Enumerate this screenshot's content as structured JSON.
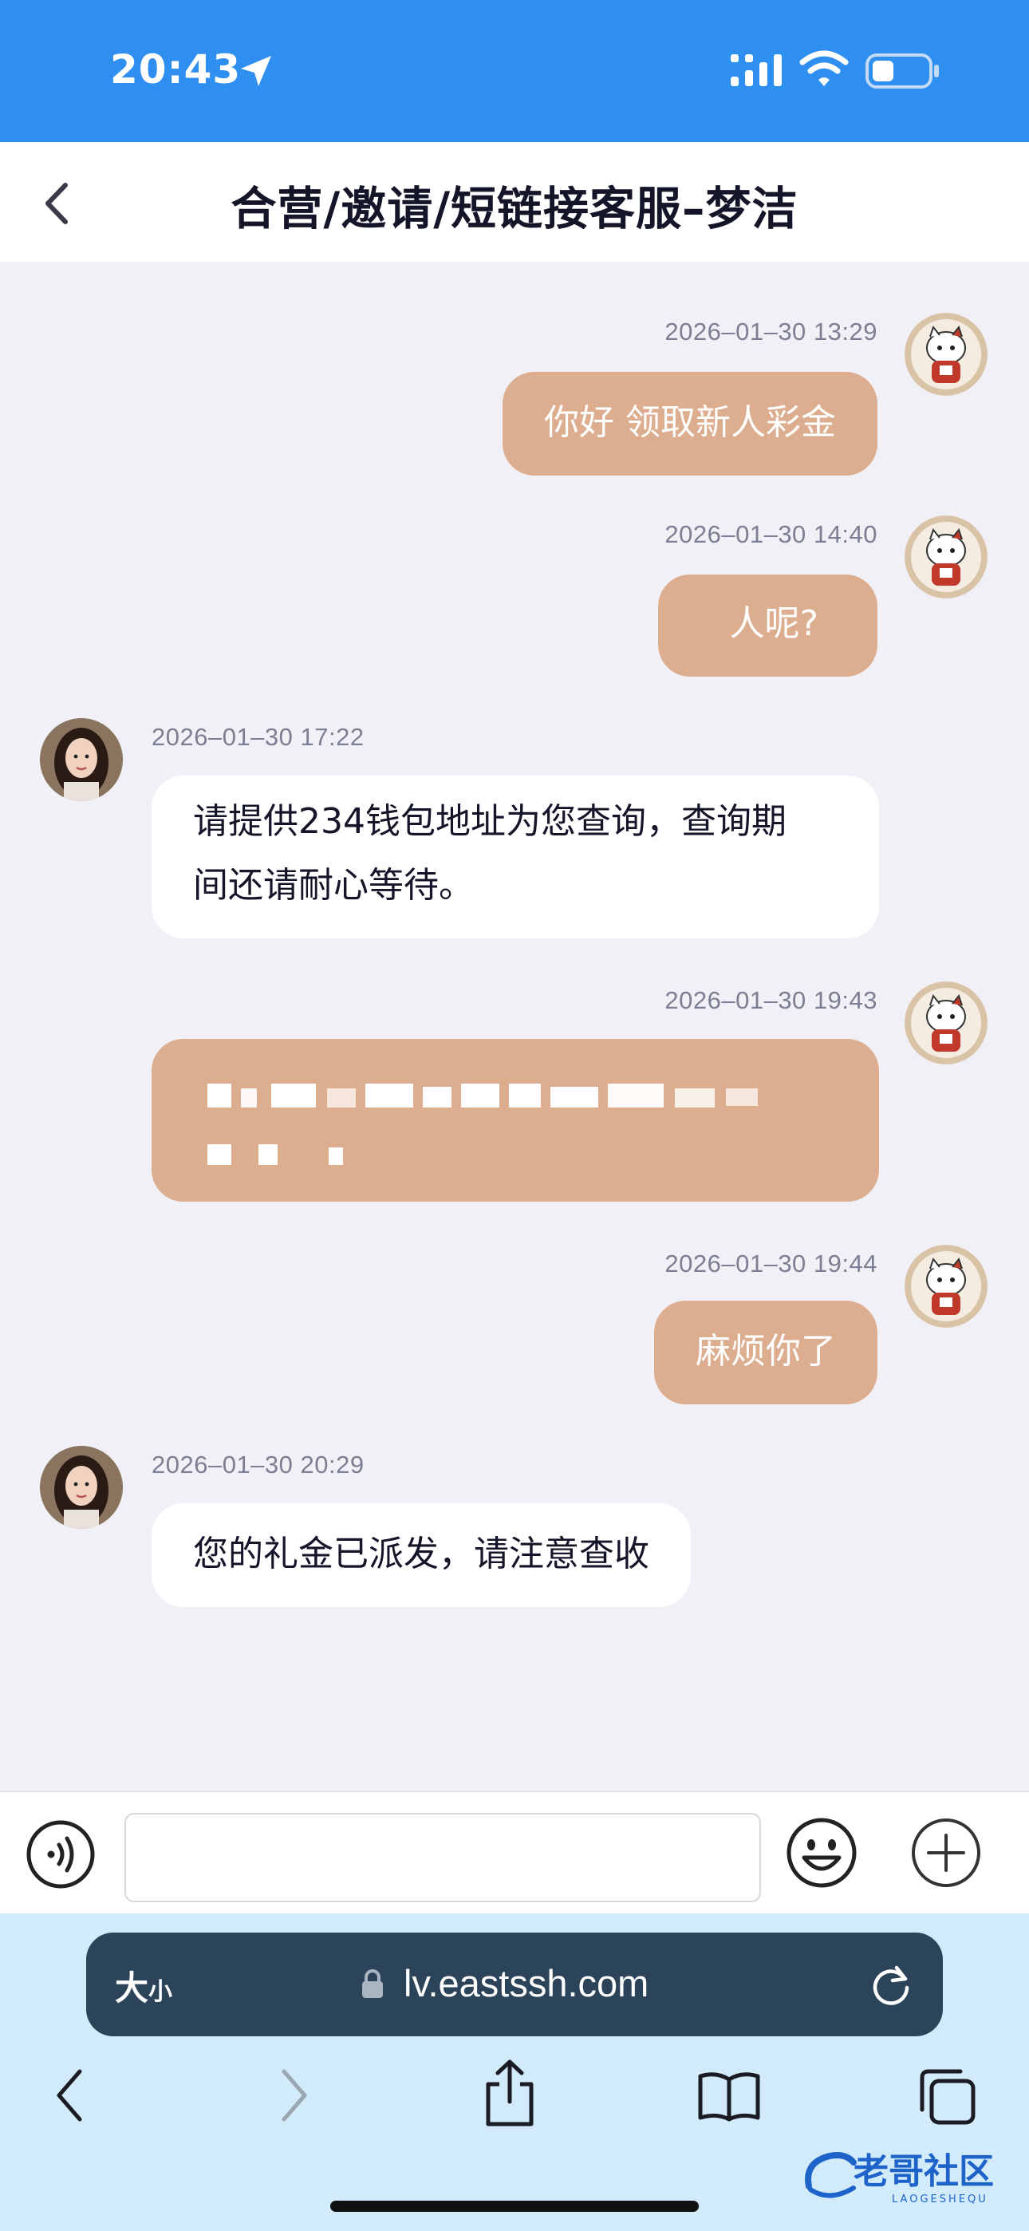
{
  "status_bar": {
    "time": "20:43"
  },
  "header": {
    "title": "合营/邀请/短链接客服–梦洁"
  },
  "messages": [
    {
      "side": "user",
      "timestamp": "2026–01–30 13:29",
      "text": "你好 领取新人彩金"
    },
    {
      "side": "user",
      "timestamp": "2026–01–30 14:40",
      "text": "人呢?"
    },
    {
      "side": "agent",
      "timestamp": "2026–01–30 17:22",
      "line1": "请提供234钱包地址为您查询，查询期",
      "line2": "间还请耐心等待。"
    },
    {
      "side": "user",
      "timestamp": "2026–01–30 19:43",
      "text": ""
    },
    {
      "side": "user",
      "timestamp": "2026–01–30 19:44",
      "text": "麻烦你了"
    },
    {
      "side": "agent",
      "timestamp": "2026–01–30 20:29",
      "text": "您的礼金已派发，请注意查收"
    }
  ],
  "input": {
    "value": "",
    "placeholder": ""
  },
  "browser": {
    "text_size_label_big": "大",
    "text_size_label_small": "小",
    "url": "lv.eastssh.com"
  },
  "watermark": {
    "text": "老哥社区",
    "subtext": "LAOGESHEQU"
  },
  "colors": {
    "status_bar": "#2f8ff0",
    "user_bubble": "#dcae8f",
    "agent_bubble": "#ffffff",
    "chat_background": "#f1f0f6",
    "url_bar": "#2b4459"
  },
  "icons": [
    "back-chevron-icon",
    "location-arrow-icon",
    "signal-icon",
    "wifi-icon",
    "battery-icon",
    "voice-icon",
    "emoji-icon",
    "add-icon",
    "lock-icon",
    "reload-icon",
    "browser-back-icon",
    "browser-forward-icon",
    "share-icon",
    "bookmarks-icon",
    "tabs-icon"
  ]
}
